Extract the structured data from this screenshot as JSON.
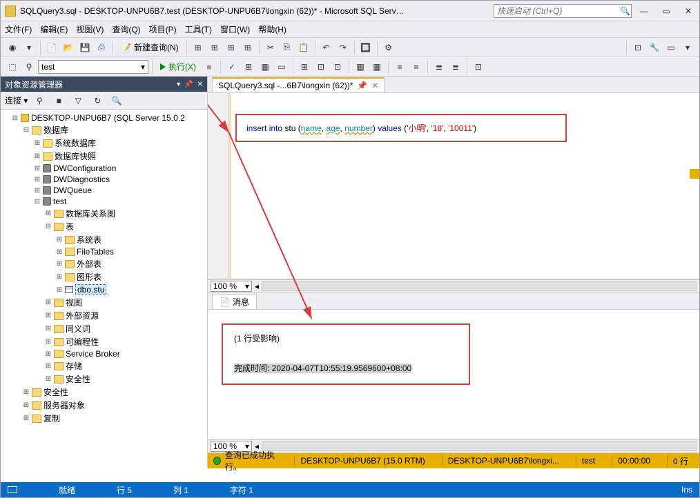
{
  "app": {
    "title": "SQLQuery3.sql - DESKTOP-UNPU6B7.test (DESKTOP-UNPU6B7\\longxin (62))* - Microsoft SQL Server Manageme...",
    "quicklaunch_placeholder": "快速启动 (Ctrl+Q)"
  },
  "menu": {
    "file": "文件(F)",
    "edit": "编辑(E)",
    "view": "视图(V)",
    "query": "查询(Q)",
    "project": "项目(P)",
    "tool": "工具(T)",
    "window": "窗口(W)",
    "help": "帮助(H)"
  },
  "toolbar": {
    "new_query": "新建查询(N)",
    "execute": "执行(X)",
    "db_dropdown": "test",
    "zoom": "100 %"
  },
  "object_explorer": {
    "title": "对象资源管理器",
    "connect_label": "连接 ▾",
    "server": "DESKTOP-UNPU6B7 (SQL Server 15.0.2",
    "nodes": {
      "databases": "数据库",
      "sys_db": "系统数据库",
      "db_snap": "数据库快照",
      "dwconfig": "DWConfiguration",
      "dwdiag": "DWDiagnostics",
      "dwqueue": "DWQueue",
      "test_db": "test",
      "diagrams": "数据库关系图",
      "tables": "表",
      "sys_tables": "系统表",
      "filetables": "FileTables",
      "ext_tables": "外部表",
      "graph_tables": "图形表",
      "dbo_stu": "dbo.stu",
      "views": "视图",
      "ext_res": "外部资源",
      "synonyms": "同义词",
      "programmability": "可编程性",
      "service_broker": "Service Broker",
      "storage": "存储",
      "db_security": "安全性",
      "security": "安全性",
      "server_objects": "服务器对象",
      "replication": "复制"
    }
  },
  "editor": {
    "tab_label": "SQLQuery3.sql -...6B7\\longxin (62))*",
    "sql_tokens": {
      "insert": "insert",
      "into": "into",
      "stu": "stu",
      "name": "name",
      "age": "age",
      "number": "number",
      "values": "values",
      "v1": "'小明'",
      "v2": "'18'",
      "v3": "'10011'"
    }
  },
  "messages": {
    "tab_label": "消息",
    "line1": "(1 行受影响)",
    "line2": "完成时间: 2020-04-07T10:55:19.9569600+08:00"
  },
  "status_bottom": {
    "ok_text": "查询已成功执行。",
    "server": "DESKTOP-UNPU6B7 (15.0 RTM)",
    "user": "DESKTOP-UNPU6B7\\longxi...",
    "db": "test",
    "time": "00:00:00",
    "rows": "0 行"
  },
  "blue_status": {
    "ready": "就绪",
    "line": "行 5",
    "col": "列 1",
    "char": "字符 1",
    "ins": "Ins"
  }
}
